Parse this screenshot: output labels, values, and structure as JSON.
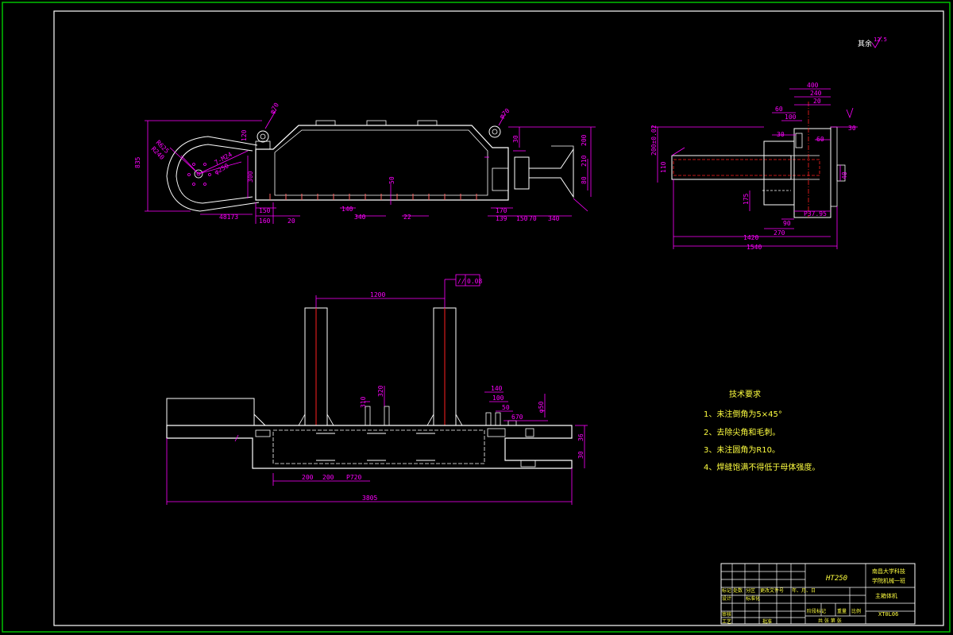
{
  "drawing": {
    "roughness_label": "其余",
    "roughness_value": "12.5",
    "material": "HT250",
    "school_line1": "南昌大学科技",
    "school_line2": "学院机械一班",
    "part_name": "主箱体机",
    "drawing_code": "XT0L06",
    "colors": {
      "background": "#000000",
      "frame_outer": "#00c000",
      "frame_inner": "#ffffff",
      "dimension": "#ff00ff",
      "outline": "#ffffff",
      "centerline": "#ff2020",
      "notes": "#ffff40"
    }
  },
  "top_view": {
    "dims": {
      "d835": "835",
      "r625": "R625",
      "r240": "R240",
      "d7m24": "7-M24",
      "phi250": "φ250",
      "d120": "120",
      "d300": "300",
      "d150a": "150",
      "d160": "160",
      "d20": "20",
      "d48173": "48173",
      "d140": "140",
      "d340a": "340",
      "d22": "22",
      "d50": "50",
      "d170": "170",
      "phi70": "φ70",
      "phi70b": "φ70",
      "d30": "30",
      "d200": "200",
      "d210": "210",
      "d80": "80",
      "d139": "139",
      "d150b": "150",
      "d70": "70",
      "d340b": "340"
    }
  },
  "side_view": {
    "dims": {
      "d400": "400",
      "d240": "240",
      "d20": "20",
      "d60a": "60",
      "d100": "100",
      "d30a": "30",
      "d30b": "30",
      "d60b": "60",
      "d200tol": "200±0.02",
      "d110": "110",
      "d40": "40",
      "d175": "175",
      "d90": "90",
      "d270": "270",
      "p3795": "P37.95",
      "d1420": "1420",
      "d1540": "1540"
    }
  },
  "front_view": {
    "dims": {
      "d1200": "1200",
      "tol_sym": "//",
      "tol_val": "0.08",
      "d320": "320",
      "d310": "310",
      "d200a": "200",
      "d200b": "200",
      "p720": "P720",
      "d140": "140",
      "d100": "100",
      "d50": "50",
      "d670": "670",
      "phi50": "φ50",
      "d36": "36",
      "d30": "30",
      "d3805": "3805"
    }
  },
  "tech_notes": {
    "title": "技术要求",
    "items": [
      "1、未注倒角为5×45°",
      "2、去除尖角和毛刺。",
      "3、未注圆角为R10。",
      "4、焊缝饱满不得低于母体强度。"
    ]
  },
  "title_block": {
    "rows": [
      [
        "标记",
        "处数",
        "分区",
        "更改文件号",
        "",
        "年、月、日"
      ],
      [
        "设计",
        "",
        "标准化",
        "",
        "",
        ""
      ],
      [
        "审核",
        "",
        "",
        "",
        "",
        ""
      ],
      [
        "工艺",
        "",
        "批准",
        "",
        "",
        ""
      ]
    ],
    "cells": {
      "stage": "阶段标记",
      "weight": "重量",
      "scale": "比例",
      "sheet": "共 张 第 张"
    }
  }
}
